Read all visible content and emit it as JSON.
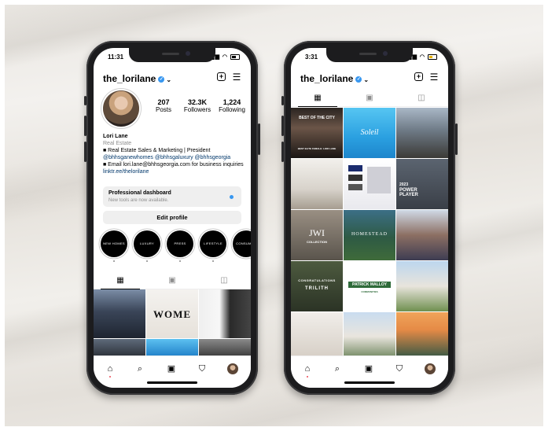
{
  "phone_left": {
    "status_time": "11:31",
    "username": "the_lorilane",
    "stats": [
      {
        "value": "207",
        "label": "Posts"
      },
      {
        "value": "32.3K",
        "label": "Followers"
      },
      {
        "value": "1,224",
        "label": "Following"
      }
    ],
    "bio": {
      "name": "Lori Lane",
      "category": "Real Estate",
      "line1": "■ Real Estate Sales & Marketing | President",
      "tags": "@bhhsganewhomes @bhhsgaluxury @bhhsgeorgia",
      "email": "■ Email lori.lane@bhhsgeorgia.com for business inquiries",
      "link": "linktr.ee/thelorilane"
    },
    "dashboard": {
      "title": "Professional dashboard",
      "subtitle": "New tools are now available."
    },
    "edit_profile": "Edit profile",
    "highlights": [
      "NEW HOMES",
      "LUXURY",
      "PRESS",
      "LIFESTYLE",
      "CONSUMER"
    ],
    "grid_text": {
      "wome": "WOME"
    }
  },
  "phone_right": {
    "status_time": "3:31",
    "username": "the_lorilane",
    "grid_text": {
      "best": "BEST OF THE CITY",
      "best_sub": "BEST ELITE FEMALE: LORI LANE",
      "soleil": "Soleil",
      "power_year": "2023",
      "power": "POWER PLAYER",
      "jwi": "JWI",
      "jwi_sub": "COLLECTION",
      "homestead": "HOMESTEAD",
      "congrats": "CONGRATULATIONS",
      "trilith": "TRILITH",
      "patrick": "PATRICK MALLOY",
      "patrick_sub": "COMMUNITIES"
    }
  },
  "colors": {
    "accent": "#3897f0",
    "text": "#000000",
    "muted": "#8e8e8e",
    "link": "#00376b"
  }
}
